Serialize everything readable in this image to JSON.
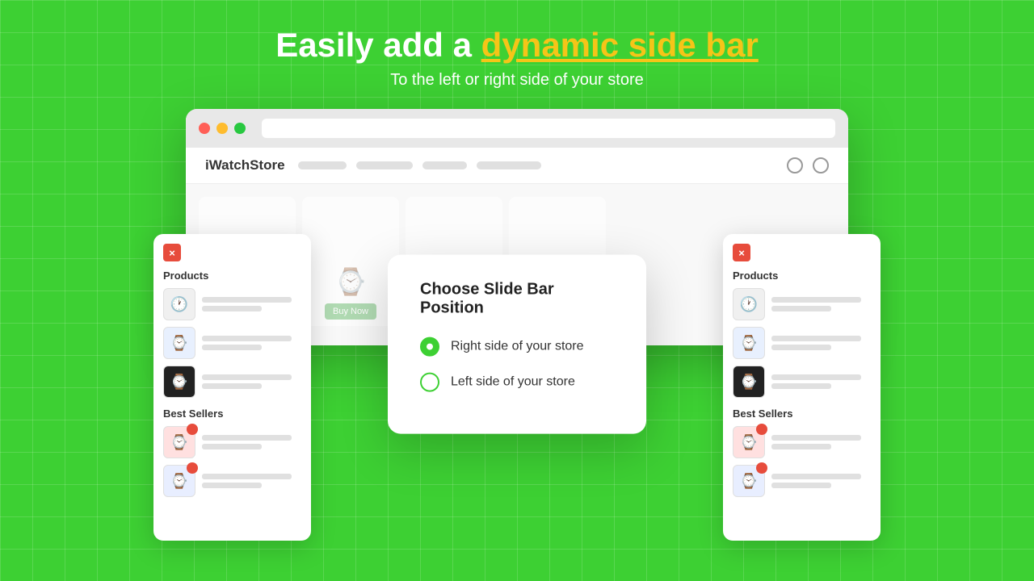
{
  "header": {
    "headline_start": "Easily add a ",
    "headline_highlight": "dynamic side bar",
    "subheadline": "To the left or right side of your store"
  },
  "browser": {
    "dots": [
      "red",
      "yellow",
      "green"
    ]
  },
  "store": {
    "logo": "iWatchStore",
    "buy_now_label": "Buy Now"
  },
  "left_panel": {
    "close_icon": "×",
    "products_title": "Products",
    "best_sellers_title": "Best Sellers",
    "products": [
      {
        "icon": "⌚",
        "has_badge": false
      },
      {
        "icon": "⌚",
        "has_badge": false
      },
      {
        "icon": "⌚",
        "has_badge": false
      }
    ],
    "best_sellers": [
      {
        "icon": "⌚",
        "has_badge": true
      },
      {
        "icon": "⌚",
        "has_badge": true
      }
    ]
  },
  "right_panel": {
    "close_icon": "×",
    "products_title": "Products",
    "best_sellers_title": "Best Sellers",
    "products": [
      {
        "icon": "⌚",
        "has_badge": false
      },
      {
        "icon": "⌚",
        "has_badge": false
      },
      {
        "icon": "⌚",
        "has_badge": false
      }
    ],
    "best_sellers": [
      {
        "icon": "⌚",
        "has_badge": true
      },
      {
        "icon": "⌚",
        "has_badge": true
      }
    ]
  },
  "modal": {
    "title": "Choose Slide Bar Position",
    "options": [
      {
        "id": "right",
        "label": "Right side of your store",
        "selected": true
      },
      {
        "id": "left",
        "label": "Left side of your store",
        "selected": false
      }
    ]
  }
}
